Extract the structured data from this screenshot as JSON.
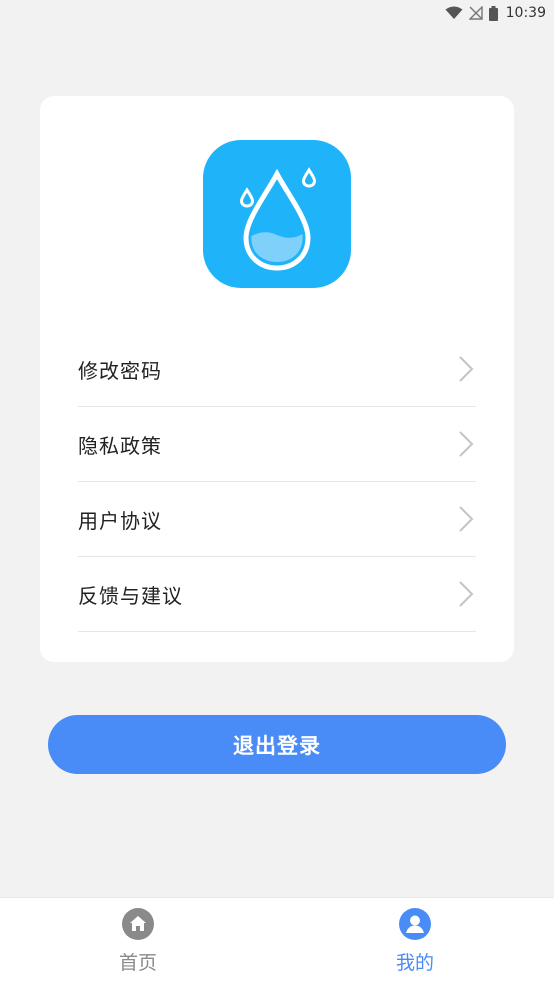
{
  "status_bar": {
    "time": "10:39",
    "icons": [
      "wifi-icon",
      "no-signal-icon",
      "battery-icon"
    ]
  },
  "app": {
    "icon": "water-drop-icon",
    "icon_color": "#1fb3f9"
  },
  "menu": {
    "items": [
      {
        "label": "修改密码",
        "icon": "chevron-right-icon"
      },
      {
        "label": "隐私政策",
        "icon": "chevron-right-icon"
      },
      {
        "label": "用户协议",
        "icon": "chevron-right-icon"
      },
      {
        "label": "反馈与建议",
        "icon": "chevron-right-icon"
      }
    ]
  },
  "logout": {
    "label": "退出登录",
    "color": "#4a8cf7"
  },
  "tab_bar": {
    "tabs": [
      {
        "label": "首页",
        "icon": "home-icon",
        "active": false,
        "color": "#8a8a8a"
      },
      {
        "label": "我的",
        "icon": "user-icon",
        "active": true,
        "color": "#4a8cf7"
      }
    ]
  }
}
